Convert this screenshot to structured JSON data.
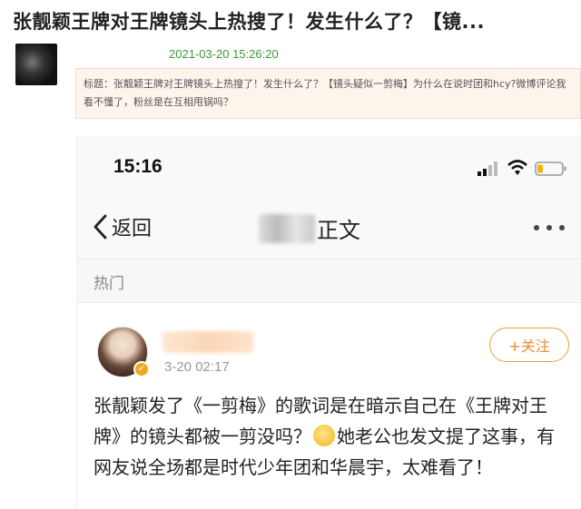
{
  "article": {
    "title": "张靓颖王牌对王牌镜头上热搜了！发生什么了？【镜...",
    "post_time": "2021-03-20 15:26:20",
    "summary": "标题：张靓颖王牌对王牌镜头上热搜了！发生什么了？【镜头疑似一剪梅】为什么在说时团和hcy?微博评论我看不懂了，粉丝是在互相甩锅吗？"
  },
  "phone": {
    "status_time": "15:16",
    "nav": {
      "back_label": "返回",
      "title_suffix": "正文"
    },
    "section_label": "热门",
    "comment": {
      "time": "3-20 02:17",
      "follow_label": "+关注",
      "text_before_emoji": "张靓颖发了《一剪梅》的歌词是在暗示自己在《王牌对王牌》的镜头都被一剪没吗？",
      "text_after_emoji": "她老公也发文提了这事，有网友说全场都是时代少年团和华晨宇，太难看了！"
    }
  }
}
